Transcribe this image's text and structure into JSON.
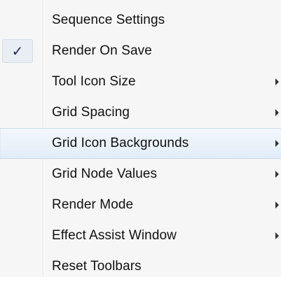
{
  "menu": {
    "items": [
      {
        "label": "Sequence Settings",
        "checked": false,
        "submenu": false,
        "highlighted": false
      },
      {
        "label": "Render On Save",
        "checked": true,
        "submenu": false,
        "highlighted": false
      },
      {
        "label": "Tool Icon Size",
        "checked": false,
        "submenu": true,
        "highlighted": false
      },
      {
        "label": "Grid Spacing",
        "checked": false,
        "submenu": true,
        "highlighted": false
      },
      {
        "label": "Grid Icon Backgrounds",
        "checked": false,
        "submenu": true,
        "highlighted": true
      },
      {
        "label": "Grid Node Values",
        "checked": false,
        "submenu": true,
        "highlighted": false
      },
      {
        "label": "Render Mode",
        "checked": false,
        "submenu": true,
        "highlighted": false
      },
      {
        "label": "Effect Assist Window",
        "checked": false,
        "submenu": true,
        "highlighted": false
      },
      {
        "label": "Reset Toolbars",
        "checked": false,
        "submenu": false,
        "highlighted": false
      }
    ],
    "check_glyph": "✓",
    "colors": {
      "background": "#f6f6f6",
      "highlight": "#e3edf8",
      "highlight_border": "#c9d9ee",
      "check_bg": "#e9eef4",
      "text": "#111111"
    }
  }
}
